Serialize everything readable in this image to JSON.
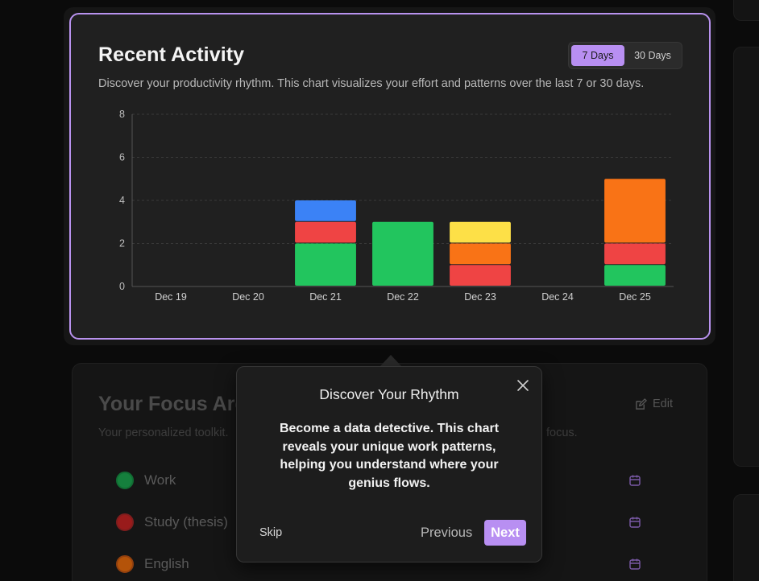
{
  "activity": {
    "title": "Recent Activity",
    "description": "Discover your productivity rhythm. This chart visualizes your effort and patterns over the last 7 or 30 days.",
    "range_options": [
      {
        "label": "7 Days",
        "active": true
      },
      {
        "label": "30 Days",
        "active": false
      }
    ]
  },
  "chart_data": {
    "type": "bar",
    "stacked": true,
    "categories": [
      "Dec 19",
      "Dec 20",
      "Dec 21",
      "Dec 22",
      "Dec 23",
      "Dec 24",
      "Dec 25"
    ],
    "series": [
      {
        "color": "#22c55e",
        "values": [
          0,
          0,
          2,
          3,
          0,
          0,
          1
        ]
      },
      {
        "color": "#ef4444",
        "values": [
          0,
          0,
          1,
          0,
          1,
          0,
          1
        ]
      },
      {
        "color": "#f97316",
        "values": [
          0,
          0,
          0,
          0,
          1,
          0,
          3
        ]
      },
      {
        "color": "#fde047",
        "values": [
          0,
          0,
          0,
          0,
          1,
          0,
          0
        ]
      },
      {
        "color": "#3b82f6",
        "values": [
          0,
          0,
          1,
          0,
          0,
          0,
          0
        ]
      }
    ],
    "yticks": [
      0,
      2,
      4,
      6,
      8
    ],
    "ylim": [
      0,
      8
    ],
    "grid": true,
    "legend": "none"
  },
  "focus": {
    "title": "Your Focus Are",
    "description": "Your personalized toolkit.",
    "description_tail": "focus.",
    "edit_label": "Edit",
    "items": [
      {
        "label": "Work",
        "color": "#15803d"
      },
      {
        "label": "Study (thesis)",
        "color": "#b91c1c"
      },
      {
        "label": "English",
        "color": "#c2410c"
      }
    ]
  },
  "tour": {
    "title": "Discover Your Rhythm",
    "body": "Become a data detective. This chart reveals your unique work patterns, helping you understand where your genius flows.",
    "skip_label": "Skip",
    "previous_label": "Previous",
    "next_label": "Next"
  },
  "colors": {
    "accent": "#b88ff2",
    "card_bg": "#202020",
    "page_bg": "#0b0b0b"
  }
}
